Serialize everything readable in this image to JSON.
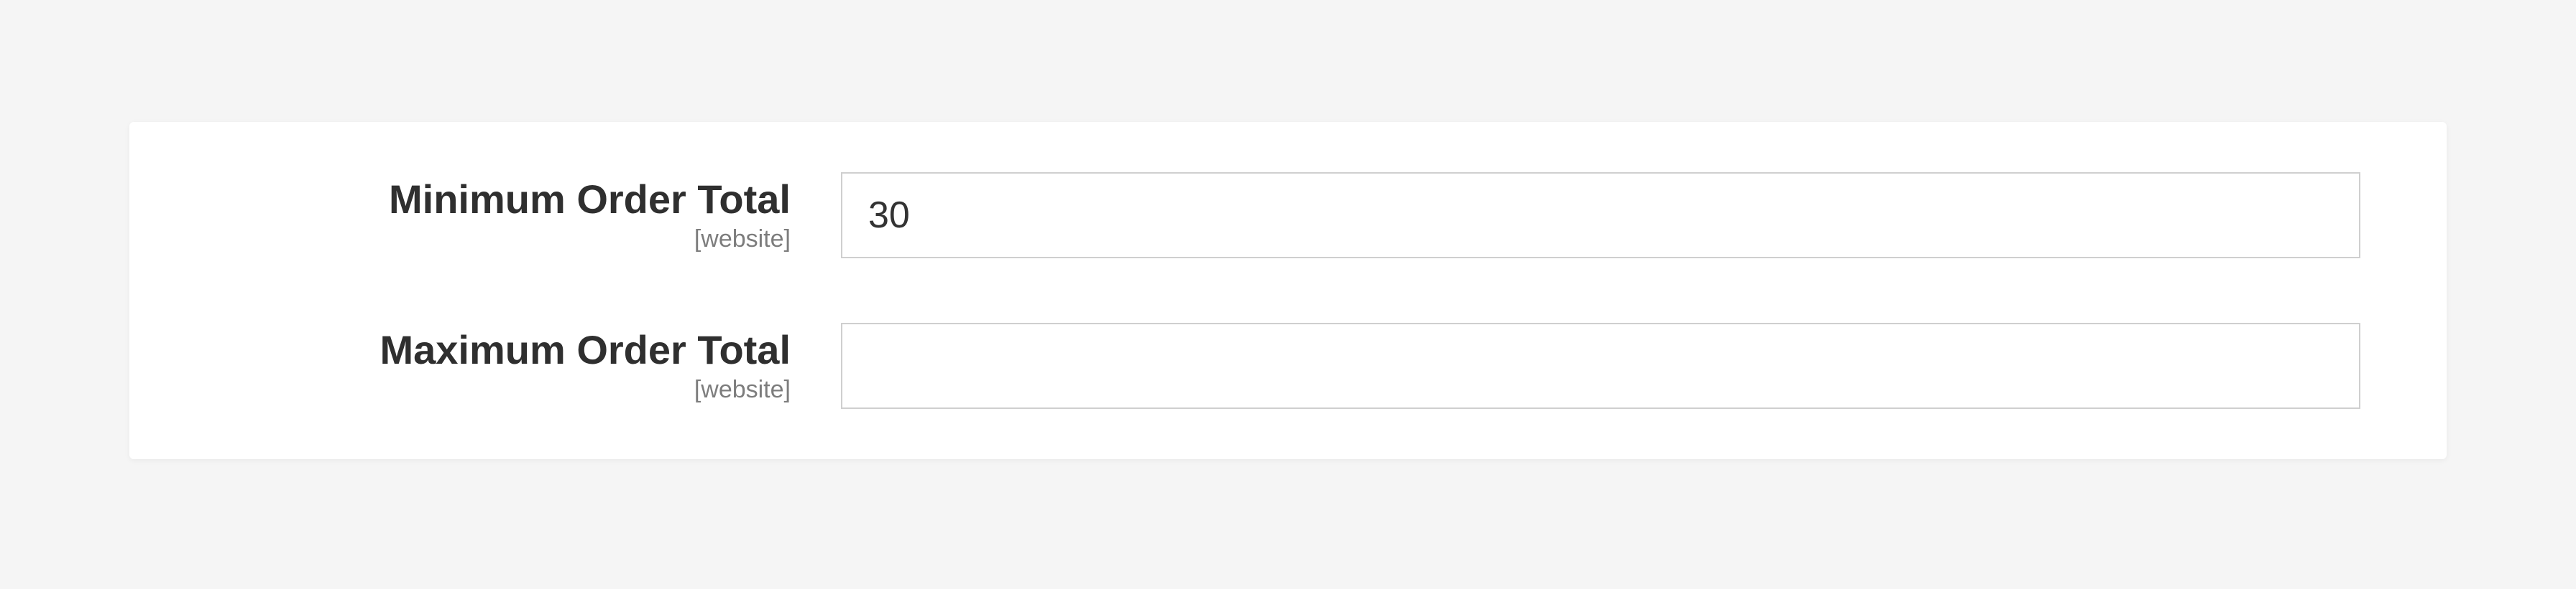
{
  "fields": {
    "min_order_total": {
      "label": "Minimum Order Total",
      "scope": "[website]",
      "value": "30"
    },
    "max_order_total": {
      "label": "Maximum Order Total",
      "scope": "[website]",
      "value": ""
    }
  }
}
